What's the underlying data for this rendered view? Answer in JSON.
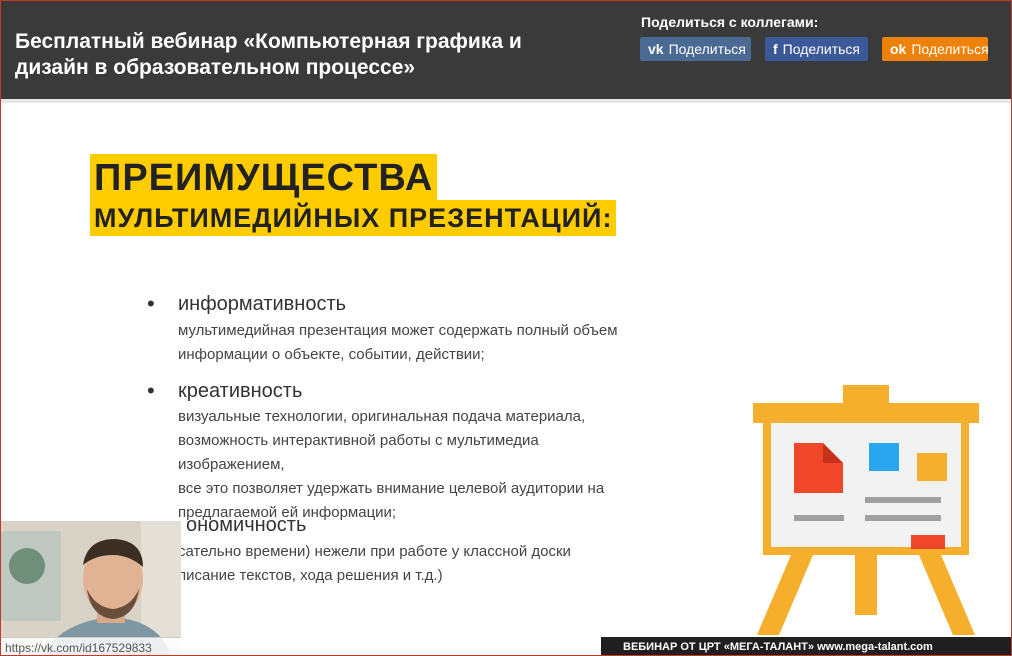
{
  "header": {
    "title": "Бесплатный вебинар «Компьютерная графика и дизайн в образовательном процессе»",
    "share_label": "Поделиться с коллегами:",
    "share_buttons": [
      {
        "icon": "vk-icon",
        "glyph": "vk",
        "label": "Поделиться",
        "color": "#4a6a93"
      },
      {
        "icon": "facebook-icon",
        "glyph": "f",
        "label": "Поделиться",
        "color": "#3b5998"
      },
      {
        "icon": "odnoklassniki-icon",
        "glyph": "ok",
        "label": "Поделиться",
        "color": "#ee8208"
      }
    ]
  },
  "slide": {
    "heading_line1": "ПРЕИМУЩЕСТВА",
    "heading_line2": "МУЛЬТИМЕДИЙНЫХ ПРЕЗЕНТАЦИЙ:",
    "items": [
      {
        "bullet": "•",
        "title": "информативность",
        "desc_lines": [
          "мультимедийная презентация может содержать полный объем",
          "информации о объекте, событии, действии;"
        ]
      },
      {
        "bullet": "•",
        "title": "креативность",
        "desc_lines": [
          "визуальные технологии, оригинальная подача материала,",
          "возможность интерактивной работы с мультимедиа изображением,",
          "все это позволяет удержать внимание целевой аудитории на",
          "предлагаемой ей информации;"
        ]
      },
      {
        "bullet": "",
        "title": "ономичность",
        "desc_lines": [
          "сательно времени) нежели при работе у классной доски",
          "писание текстов, хода решения и т.д.)"
        ]
      }
    ],
    "accent_color": "#ffcc00"
  },
  "webcam": {
    "link_text": "https://vk.com/id167529833"
  },
  "banner": {
    "text": "ВЕБИНАР ОТ ЦРТ «МЕГА-ТАЛАНТ» www.mega-talant.com"
  }
}
